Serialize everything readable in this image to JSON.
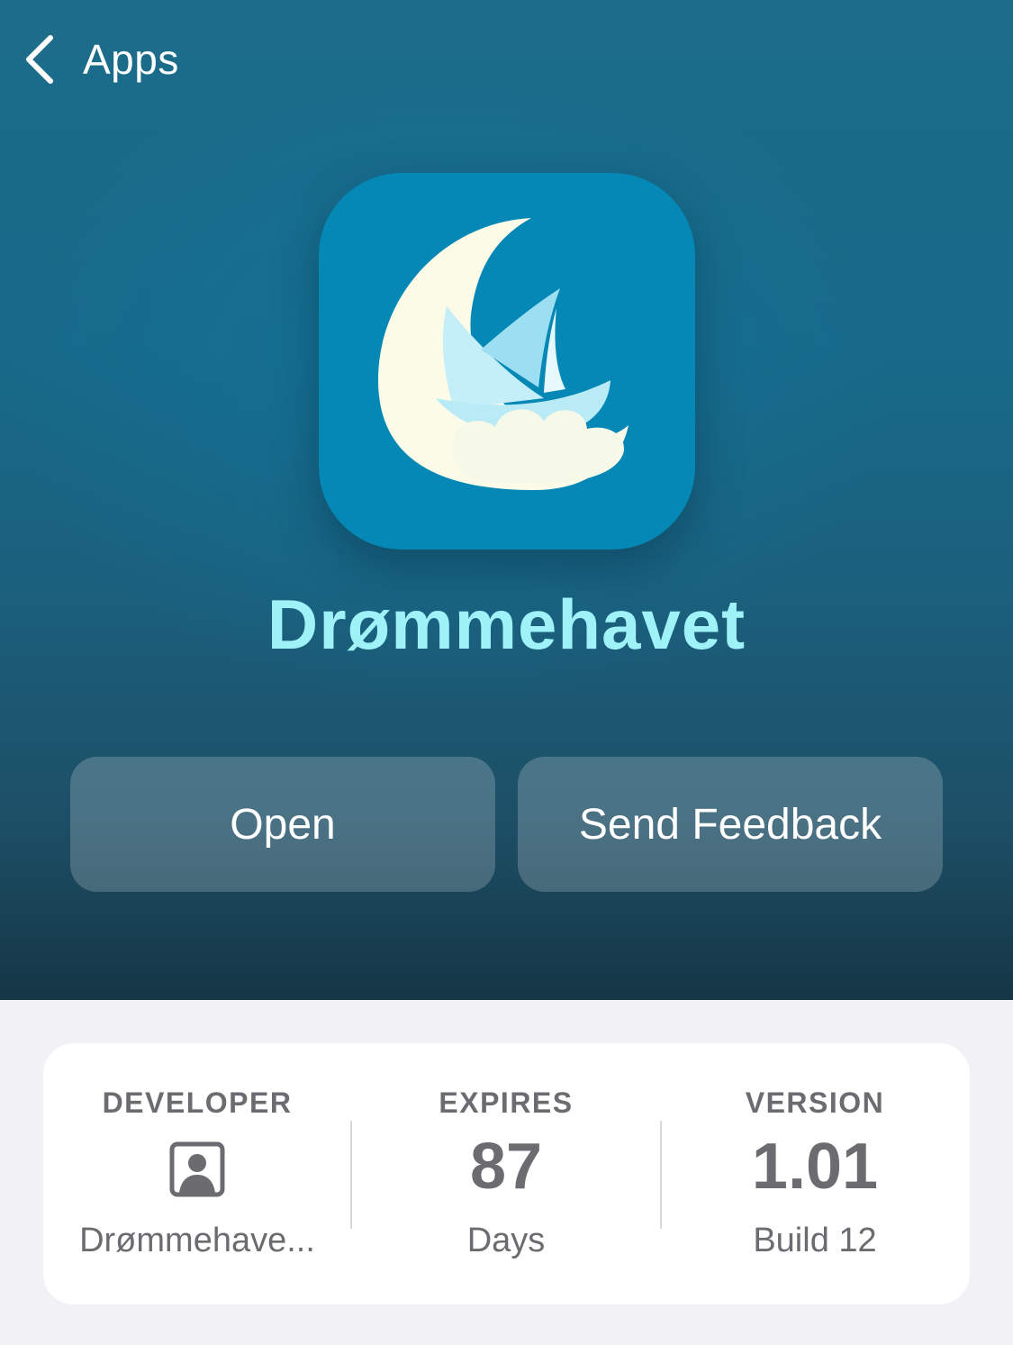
{
  "nav": {
    "back_label": "Apps",
    "back_icon": "chevron-left-icon"
  },
  "app": {
    "name": "Drømmehavet",
    "icon": "moon-sailboat-app-icon",
    "name_color": "#9ff3f8",
    "icon_background": "#0588b5"
  },
  "actions": {
    "open_label": "Open",
    "feedback_label": "Send Feedback"
  },
  "info": {
    "developer": {
      "header": "DEVELOPER",
      "icon": "person-icon",
      "value": "Drømmehave..."
    },
    "expires": {
      "header": "EXPIRES",
      "value": "87",
      "unit": "Days"
    },
    "version": {
      "header": "VERSION",
      "value": "1.01",
      "build": "Build 12"
    }
  }
}
